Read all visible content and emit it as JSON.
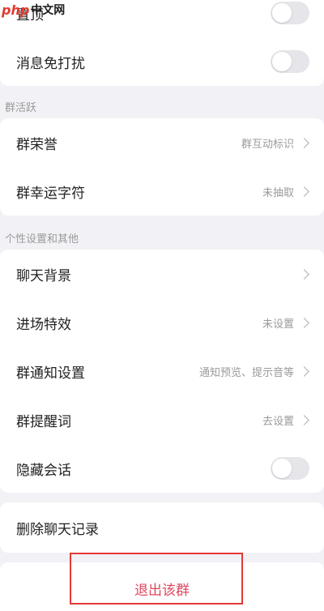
{
  "watermark": {
    "logo": "php",
    "text": "中文网"
  },
  "top_card": {
    "rows": [
      {
        "title": "置顶",
        "toggle_on": false
      },
      {
        "title": "消息免打扰",
        "toggle_on": false
      }
    ]
  },
  "section_activity": {
    "header": "群活跃",
    "rows": [
      {
        "title": "群荣誉",
        "value": "群互动标识"
      },
      {
        "title": "群幸运字符",
        "value": "未抽取"
      }
    ]
  },
  "section_personal": {
    "header": "个性设置和其他",
    "rows": [
      {
        "title": "聊天背景",
        "value": ""
      },
      {
        "title": "进场特效",
        "value": "未设置"
      },
      {
        "title": "群通知设置",
        "value": "通知预览、提示音等"
      },
      {
        "title": "群提醒词",
        "value": "去设置"
      },
      {
        "title": "隐藏会话",
        "toggle_on": false
      }
    ]
  },
  "delete_card": {
    "label": "删除聊天记录"
  },
  "exit": {
    "label": "退出该群"
  },
  "colors": {
    "background": "#f2f2f6",
    "exit_text": "#e0475f",
    "highlight_border": "#e53935",
    "toggle_off": "#e5e5ea"
  }
}
